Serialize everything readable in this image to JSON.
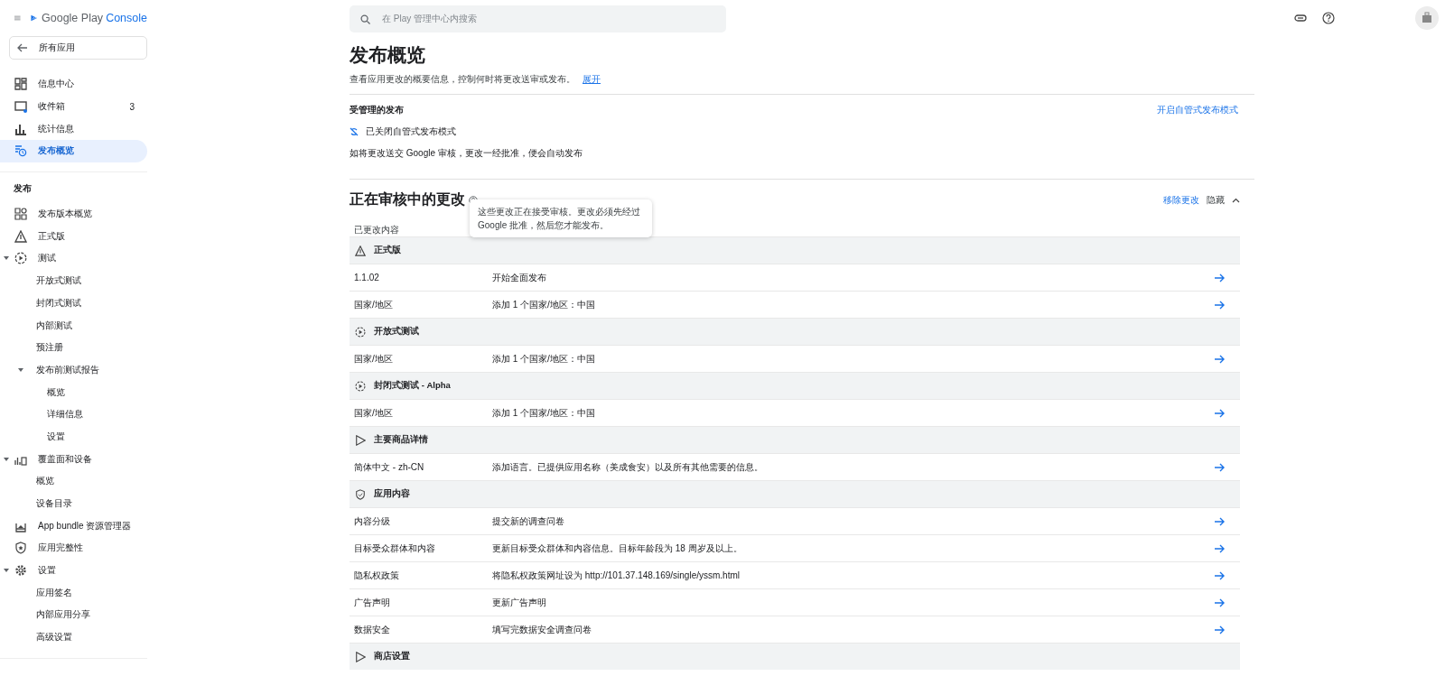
{
  "app_header": {
    "logo_text": "Google Play",
    "logo_product": "Console"
  },
  "back_button": "所有应用",
  "nav": [
    {
      "label": "信息中心",
      "selected": false
    },
    {
      "label": "收件箱",
      "badge": "3",
      "selected": false
    },
    {
      "label": "统计信息",
      "selected": false
    },
    {
      "label": "发布概览",
      "selected": true
    }
  ],
  "section": {
    "title": "发布",
    "items": [
      {
        "label": "发布版本概览",
        "selected": false,
        "expanded": false
      },
      {
        "label": "正式版",
        "selected": false,
        "expanded": false
      },
      {
        "label": "测试",
        "selected": false,
        "expanded": true,
        "children": [
          {
            "label": "开放式测试",
            "selected": false,
            "expanded": false
          },
          {
            "label": "封闭式测试",
            "selected": false,
            "expanded": false
          },
          {
            "label": "内部测试",
            "selected": false,
            "expanded": false
          },
          {
            "label": "预注册",
            "selected": false,
            "expanded": false
          },
          {
            "label": "发布前测试报告",
            "selected": false,
            "expanded": true,
            "children": [
              {
                "label": "概览",
                "selected": false
              },
              {
                "label": "详细信息",
                "selected": false
              },
              {
                "label": "设置",
                "selected": false
              }
            ]
          }
        ]
      },
      {
        "label": "覆盖面和设备",
        "selected": false,
        "expanded": true,
        "children": [
          {
            "label": "概览",
            "selected": false,
            "expanded": false
          },
          {
            "label": "设备目录",
            "selected": false,
            "expanded": false
          }
        ]
      },
      {
        "label": "App bundle 资源管理器",
        "selected": false,
        "expanded": false
      },
      {
        "label": "应用完整性",
        "selected": false,
        "expanded": false
      },
      {
        "label": "设置",
        "selected": false,
        "expanded": true,
        "children": [
          {
            "label": "应用签名",
            "selected": false,
            "expanded": false
          },
          {
            "label": "内部应用分享",
            "selected": false,
            "expanded": false
          },
          {
            "label": "高级设置",
            "selected": false,
            "expanded": false
          }
        ]
      }
    ]
  },
  "search": {
    "placeholder": "在 Play 管理中心内搜索"
  },
  "page": {
    "title": "发布概览",
    "subtitle": "查看应用更改的概要信息，控制何时将更改送审或发布。",
    "subtitle_link": "展开"
  },
  "managed": {
    "title": "受管理的发布",
    "action": "开启自管式发布模式",
    "status": "已关闭自管式发布模式",
    "note": "如将更改送交 Google 审核，更改一经批准，便会自动发布"
  },
  "review": {
    "title": "正在审核中的更改",
    "remove": "移除更改",
    "hide": "隐藏",
    "expanded": true,
    "tooltip": "这些更改正在接受审核。更改必须先经过 Google 批准，然后您才能发布。",
    "column_1": "已更改内容",
    "groups": [
      {
        "title": "正式版",
        "rows": [
          {
            "item": "1.1.02",
            "change": "开始全面发布"
          },
          {
            "item": "国家/地区",
            "change": "添加 1 个国家/地区：中国"
          }
        ]
      },
      {
        "title": "开放式测试",
        "rows": [
          {
            "item": "国家/地区",
            "change": "添加 1 个国家/地区：中国"
          }
        ]
      },
      {
        "title": "封闭式测试 - Alpha",
        "rows": [
          {
            "item": "国家/地区",
            "change": "添加 1 个国家/地区：中国"
          }
        ]
      },
      {
        "title": "主要商品详情",
        "rows": [
          {
            "item": "简体中文 - zh-CN",
            "change": "添加语言。已提供应用名称（美成食安）以及所有其他需要的信息。"
          }
        ]
      },
      {
        "title": "应用内容",
        "rows": [
          {
            "item": "内容分级",
            "change": "提交新的调查问卷"
          },
          {
            "item": "目标受众群体和内容",
            "change": "更新目标受众群体和内容信息。目标年龄段为 18 周岁及以上。"
          },
          {
            "item": "隐私权政策",
            "change": "将隐私权政策网址设为 http://101.37.148.169/single/yssm.html"
          },
          {
            "item": "广告声明",
            "change": "更新广告声明"
          },
          {
            "item": "数据安全",
            "change": "填写完数据安全调查问卷"
          }
        ]
      },
      {
        "title": "商店设置"
      }
    ]
  }
}
